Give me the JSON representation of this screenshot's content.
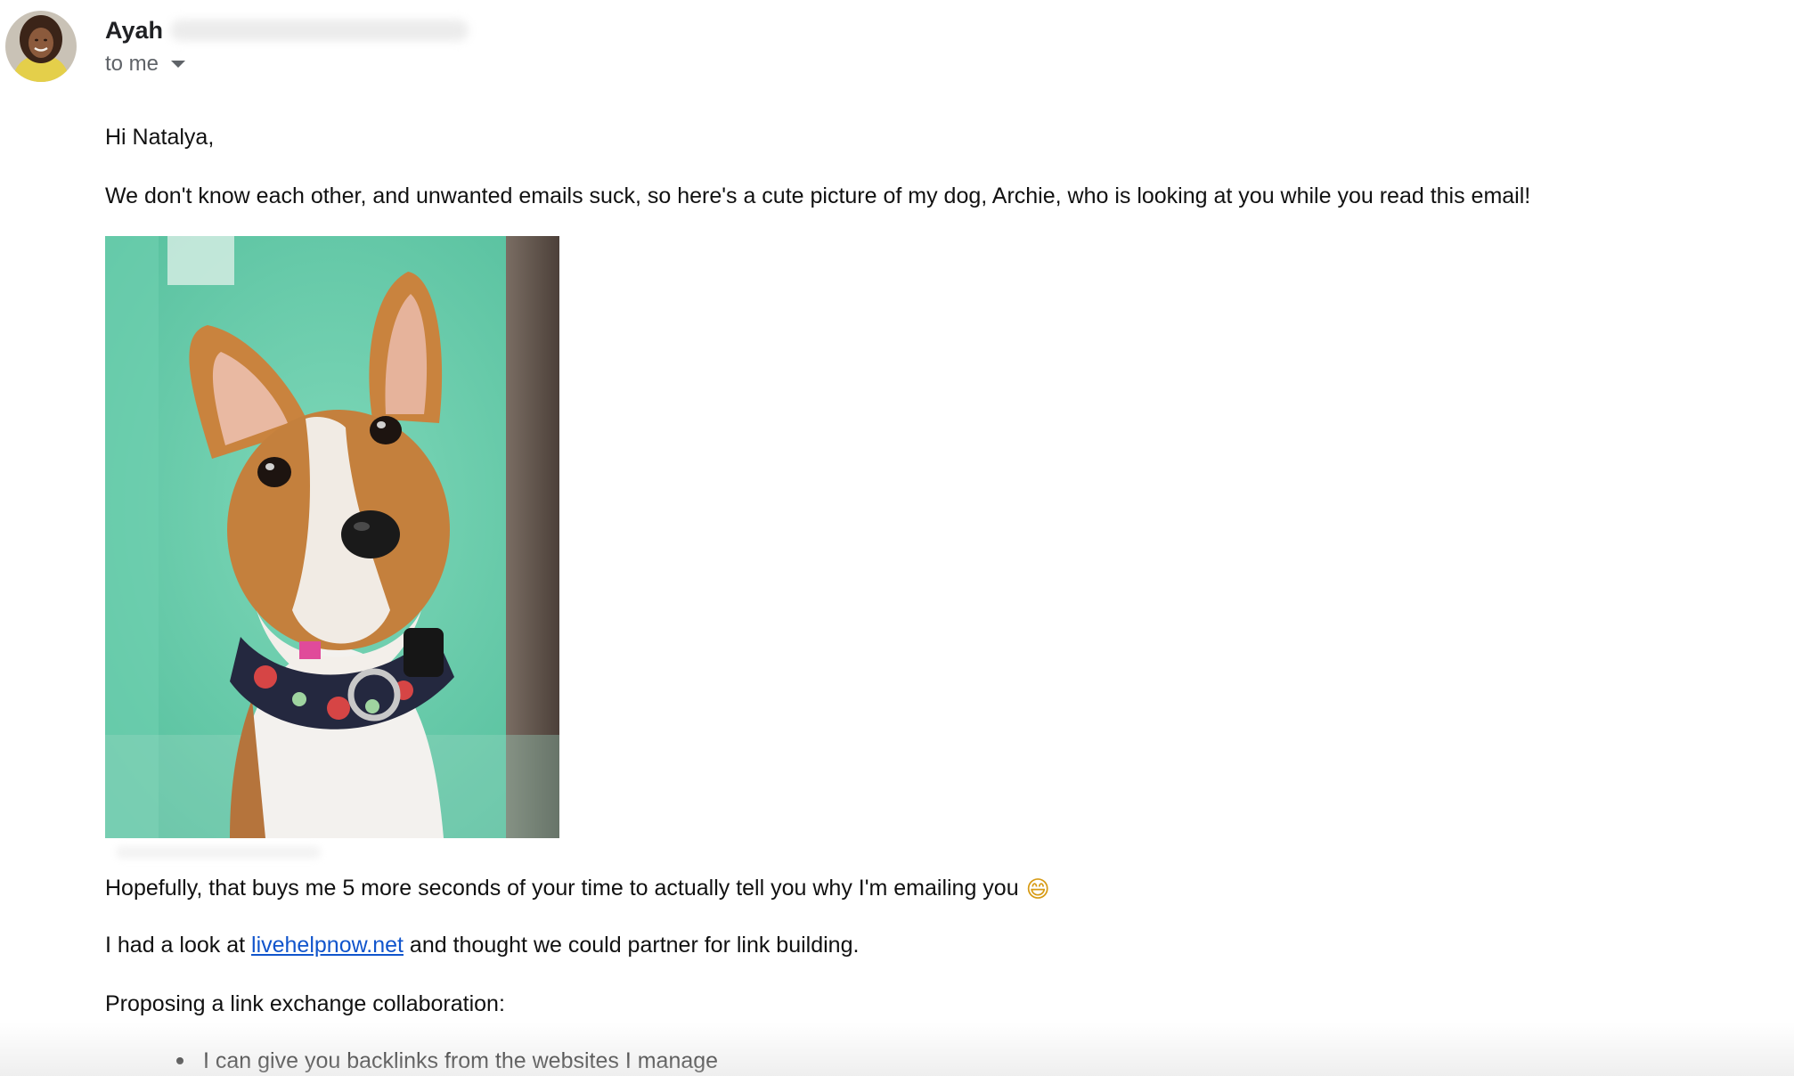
{
  "header": {
    "sender_name": "Ayah",
    "recipient_label": "to me"
  },
  "body": {
    "greeting": "Hi Natalya,",
    "intro": "We don't know each other, and unwanted emails suck, so here's a cute picture of my dog, Archie, who is looking at you while you read this email!",
    "hopefully": "Hopefully, that buys me 5 more seconds of your time to actually tell you why I'm emailing you",
    "hopefully_emoji": "😄",
    "look_prefix": "I had a look at ",
    "look_link": "livehelpnow.net",
    "look_suffix": " and thought we could partner for link building.",
    "proposing": "Proposing a link exchange collaboration:",
    "bullets": [
      "I can give you backlinks from the websites I manage"
    ]
  },
  "icons": {
    "avatar": "sender-avatar-photo",
    "recipient_caret": "chevron-down-icon",
    "photo": "dog-photo"
  },
  "colors": {
    "link": "#1155cc",
    "secondary_text": "#5f6368",
    "photo_background": "#5ec9a6"
  }
}
